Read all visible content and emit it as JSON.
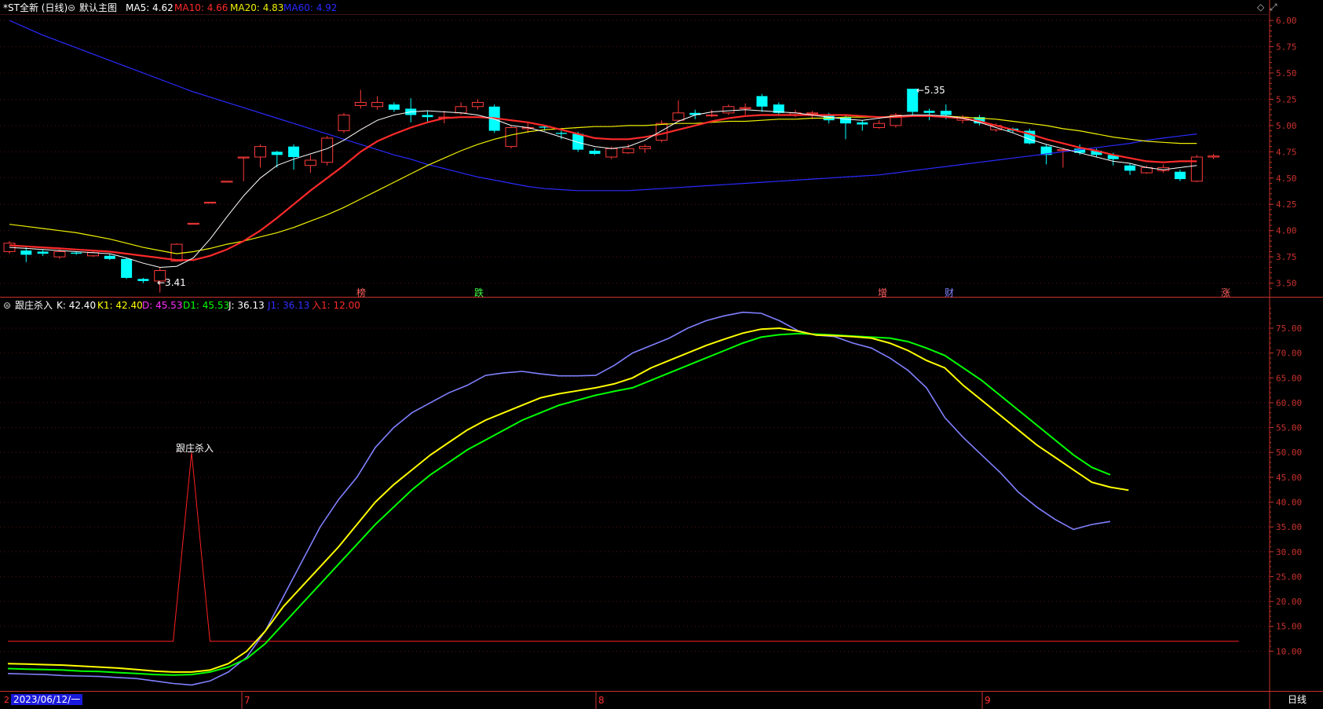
{
  "header": {
    "title": "*ST全新 (日线)",
    "main_chart_name": "默认主图",
    "ma5_label": "MA5: 4.62",
    "ma10_label": "MA10: 4.66",
    "ma20_label": "MA20: 4.83",
    "ma60_label": "MA60: 4.92"
  },
  "indicator_header": {
    "name": "跟庄杀入",
    "k_label": "K: 42.40",
    "k1_label": "K1: 42.40",
    "d_label": "D: 45.53",
    "d1_label": "D1: 45.53",
    "j_label": "J: 36.13",
    "j1_label": "J1: 36.13",
    "r1_label": "入1: 12.00"
  },
  "colors": {
    "ma5": "#ffffff",
    "ma10": "#ff2a2a",
    "ma20": "#f0f000",
    "ma60": "#2a2aff",
    "up": "#ff3a3a",
    "down": "#00ffff",
    "k": "#ffff00",
    "d": "#00ff00",
    "j": "#8080ff",
    "signal": "#ff2020",
    "axis": "#c8322d"
  },
  "markers": {
    "low_label": "←3.41",
    "high_label": "←5.35",
    "event_tags": [
      "榜",
      "跌",
      "增",
      "财",
      "涨"
    ],
    "signal_label": "跟庄杀入"
  },
  "footer": {
    "date_label": "2023/06/12/一",
    "month_7": "7",
    "month_8": "8",
    "month_9": "9",
    "period_button": "日线"
  },
  "chart_data": {
    "type": "candlestick",
    "price_axis": {
      "ylim": [
        3.37,
        6.06
      ],
      "ticks": [
        "6.00",
        "5.75",
        "5.50",
        "5.25",
        "5.00",
        "4.75",
        "4.50",
        "4.25",
        "4.00",
        "3.75",
        "3.50"
      ]
    },
    "indicator_axis": {
      "ylim": [
        2,
        81
      ],
      "ticks": [
        "75.00",
        "70.00",
        "65.00",
        "60.00",
        "55.00",
        "50.00",
        "45.00",
        "40.00",
        "35.00",
        "30.00",
        "25.00",
        "20.00",
        "15.00",
        "10.00"
      ]
    },
    "candles": [
      {
        "o": 3.8,
        "c": 3.88,
        "h": 3.9,
        "l": 3.78
      },
      {
        "o": 3.81,
        "c": 3.77,
        "h": 3.84,
        "l": 3.7
      },
      {
        "o": 3.8,
        "c": 3.78,
        "h": 3.82,
        "l": 3.76
      },
      {
        "o": 3.75,
        "c": 3.8,
        "h": 3.82,
        "l": 3.73
      },
      {
        "o": 3.79,
        "c": 3.78,
        "h": 3.8,
        "l": 3.77
      },
      {
        "o": 3.76,
        "c": 3.79,
        "h": 3.81,
        "l": 3.75
      },
      {
        "o": 3.76,
        "c": 3.73,
        "h": 3.78,
        "l": 3.72
      },
      {
        "o": 3.73,
        "c": 3.55,
        "h": 3.74,
        "l": 3.54
      },
      {
        "o": 3.54,
        "c": 3.52,
        "h": 3.55,
        "l": 3.5
      },
      {
        "o": 3.52,
        "c": 3.62,
        "h": 3.65,
        "l": 3.41
      },
      {
        "o": 3.71,
        "c": 3.87,
        "h": 3.88,
        "l": 3.71
      },
      {
        "o": 4.07,
        "c": 4.07,
        "h": 4.07,
        "l": 4.07
      },
      {
        "o": 4.27,
        "c": 4.27,
        "h": 4.27,
        "l": 4.27
      },
      {
        "o": 4.47,
        "c": 4.47,
        "h": 4.47,
        "l": 4.47
      },
      {
        "o": 4.7,
        "c": 4.7,
        "h": 4.7,
        "l": 4.47
      },
      {
        "o": 4.7,
        "c": 4.8,
        "h": 4.82,
        "l": 4.6
      },
      {
        "o": 4.75,
        "c": 4.72,
        "h": 4.76,
        "l": 4.6
      },
      {
        "o": 4.8,
        "c": 4.7,
        "h": 4.82,
        "l": 4.58
      },
      {
        "o": 4.62,
        "c": 4.67,
        "h": 4.72,
        "l": 4.55
      },
      {
        "o": 4.65,
        "c": 4.88,
        "h": 4.9,
        "l": 4.62
      },
      {
        "o": 4.95,
        "c": 5.1,
        "h": 5.12,
        "l": 4.93
      },
      {
        "o": 5.19,
        "c": 5.22,
        "h": 5.34,
        "l": 5.16
      },
      {
        "o": 5.18,
        "c": 5.22,
        "h": 5.28,
        "l": 5.15
      },
      {
        "o": 5.2,
        "c": 5.15,
        "h": 5.22,
        "l": 5.13
      },
      {
        "o": 5.16,
        "c": 5.1,
        "h": 5.26,
        "l": 5.03
      },
      {
        "o": 5.1,
        "c": 5.08,
        "h": 5.14,
        "l": 5.02
      },
      {
        "o": 5.08,
        "c": 5.08,
        "h": 5.14,
        "l": 5.02
      },
      {
        "o": 5.12,
        "c": 5.18,
        "h": 5.22,
        "l": 5.1
      },
      {
        "o": 5.18,
        "c": 5.22,
        "h": 5.25,
        "l": 5.15
      },
      {
        "o": 5.18,
        "c": 4.95,
        "h": 5.2,
        "l": 4.93
      },
      {
        "o": 4.8,
        "c": 4.98,
        "h": 5.0,
        "l": 4.78
      },
      {
        "o": 4.97,
        "c": 4.98,
        "h": 5.03,
        "l": 4.93
      },
      {
        "o": 4.99,
        "c": 4.98,
        "h": 5.0,
        "l": 4.95
      },
      {
        "o": 4.93,
        "c": 4.92,
        "h": 4.95,
        "l": 4.87
      },
      {
        "o": 4.92,
        "c": 4.77,
        "h": 4.94,
        "l": 4.75
      },
      {
        "o": 4.76,
        "c": 4.73,
        "h": 4.78,
        "l": 4.72
      },
      {
        "o": 4.7,
        "c": 4.78,
        "h": 4.8,
        "l": 4.68
      },
      {
        "o": 4.74,
        "c": 4.78,
        "h": 4.82,
        "l": 4.73
      },
      {
        "o": 4.78,
        "c": 4.8,
        "h": 4.82,
        "l": 4.74
      },
      {
        "o": 4.86,
        "c": 5.02,
        "h": 5.05,
        "l": 4.84
      },
      {
        "o": 5.05,
        "c": 5.12,
        "h": 5.24,
        "l": 5.04
      },
      {
        "o": 5.12,
        "c": 5.1,
        "h": 5.15,
        "l": 5.06
      },
      {
        "o": 5.1,
        "c": 5.1,
        "h": 5.15,
        "l": 5.08
      },
      {
        "o": 5.12,
        "c": 5.18,
        "h": 5.2,
        "l": 5.1
      },
      {
        "o": 5.17,
        "c": 5.17,
        "h": 5.21,
        "l": 5.1
      },
      {
        "o": 5.28,
        "c": 5.18,
        "h": 5.3,
        "l": 5.13
      },
      {
        "o": 5.2,
        "c": 5.12,
        "h": 5.22,
        "l": 5.1
      },
      {
        "o": 5.1,
        "c": 5.12,
        "h": 5.15,
        "l": 5.08
      },
      {
        "o": 5.12,
        "c": 5.12,
        "h": 5.14,
        "l": 5.06
      },
      {
        "o": 5.1,
        "c": 5.05,
        "h": 5.12,
        "l": 5.02
      },
      {
        "o": 5.08,
        "c": 5.02,
        "h": 5.1,
        "l": 4.87
      },
      {
        "o": 5.03,
        "c": 5.01,
        "h": 5.05,
        "l": 4.95
      },
      {
        "o": 4.98,
        "c": 5.02,
        "h": 5.05,
        "l": 4.97
      },
      {
        "o": 5.0,
        "c": 5.1,
        "h": 5.12,
        "l": 4.98
      },
      {
        "o": 5.35,
        "c": 5.13,
        "h": 5.35,
        "l": 5.1
      },
      {
        "o": 5.14,
        "c": 5.12,
        "h": 5.16,
        "l": 5.05
      },
      {
        "o": 5.14,
        "c": 5.1,
        "h": 5.2,
        "l": 5.06
      },
      {
        "o": 5.05,
        "c": 5.08,
        "h": 5.1,
        "l": 5.02
      },
      {
        "o": 5.08,
        "c": 5.02,
        "h": 5.1,
        "l": 5.0
      },
      {
        "o": 4.96,
        "c": 5.0,
        "h": 5.02,
        "l": 4.94
      },
      {
        "o": 4.97,
        "c": 4.95,
        "h": 4.98,
        "l": 4.93
      },
      {
        "o": 4.95,
        "c": 4.83,
        "h": 4.97,
        "l": 4.82
      },
      {
        "o": 4.8,
        "c": 4.72,
        "h": 4.82,
        "l": 4.63
      },
      {
        "o": 4.77,
        "c": 4.77,
        "h": 4.78,
        "l": 4.6
      },
      {
        "o": 4.78,
        "c": 4.74,
        "h": 4.82,
        "l": 4.72
      },
      {
        "o": 4.76,
        "c": 4.72,
        "h": 4.78,
        "l": 4.7
      },
      {
        "o": 4.72,
        "c": 4.68,
        "h": 4.74,
        "l": 4.62
      },
      {
        "o": 4.62,
        "c": 4.57,
        "h": 4.64,
        "l": 4.53
      },
      {
        "o": 4.55,
        "c": 4.6,
        "h": 4.62,
        "l": 4.54
      },
      {
        "o": 4.57,
        "c": 4.6,
        "h": 4.63,
        "l": 4.55
      },
      {
        "o": 4.56,
        "c": 4.49,
        "h": 4.58,
        "l": 4.47
      },
      {
        "o": 4.47,
        "c": 4.7,
        "h": 4.72,
        "l": 4.46
      },
      {
        "o": 4.7,
        "c": 4.71,
        "h": 4.73,
        "l": 4.68
      }
    ],
    "ma5": [
      3.84,
      3.83,
      3.82,
      3.81,
      3.8,
      3.79,
      3.78,
      3.74,
      3.69,
      3.65,
      3.66,
      3.74,
      3.92,
      4.13,
      4.33,
      4.5,
      4.62,
      4.68,
      4.73,
      4.78,
      4.86,
      4.96,
      5.05,
      5.1,
      5.13,
      5.14,
      5.13,
      5.12,
      5.1,
      5.06,
      5.0,
      4.98,
      4.94,
      4.89,
      4.84,
      4.8,
      4.78,
      4.8,
      4.86,
      4.95,
      5.04,
      5.1,
      5.13,
      5.14,
      5.15,
      5.14,
      5.13,
      5.12,
      5.1,
      5.08,
      5.06,
      5.05,
      5.07,
      5.09,
      5.1,
      5.1,
      5.09,
      5.07,
      5.03,
      4.98,
      4.93,
      4.87,
      4.82,
      4.78,
      4.74,
      4.7,
      4.66,
      4.64,
      4.6,
      4.58,
      4.6,
      4.62
    ],
    "ma10": [
      3.86,
      3.85,
      3.84,
      3.83,
      3.82,
      3.81,
      3.8,
      3.78,
      3.76,
      3.74,
      3.72,
      3.72,
      3.76,
      3.82,
      3.9,
      4.0,
      4.12,
      4.25,
      4.38,
      4.5,
      4.62,
      4.75,
      4.85,
      4.92,
      4.98,
      5.03,
      5.07,
      5.08,
      5.08,
      5.07,
      5.05,
      5.03,
      5.0,
      4.96,
      4.92,
      4.88,
      4.87,
      4.87,
      4.89,
      4.92,
      4.96,
      5.0,
      5.04,
      5.07,
      5.09,
      5.1,
      5.1,
      5.1,
      5.1,
      5.1,
      5.1,
      5.09,
      5.08,
      5.08,
      5.09,
      5.09,
      5.08,
      5.07,
      5.04,
      5.0,
      4.96,
      4.92,
      4.87,
      4.83,
      4.79,
      4.76,
      4.72,
      4.69,
      4.66,
      4.65,
      4.66,
      4.66
    ],
    "ma20": [
      4.06,
      4.04,
      4.02,
      4.0,
      3.98,
      3.95,
      3.92,
      3.88,
      3.84,
      3.81,
      3.78,
      3.8,
      3.83,
      3.87,
      3.9,
      3.94,
      3.98,
      4.03,
      4.09,
      4.15,
      4.22,
      4.3,
      4.38,
      4.46,
      4.54,
      4.62,
      4.69,
      4.76,
      4.82,
      4.87,
      4.91,
      4.94,
      4.96,
      4.97,
      4.98,
      4.99,
      4.99,
      5.0,
      5.0,
      5.01,
      5.02,
      5.02,
      5.03,
      5.04,
      5.04,
      5.05,
      5.06,
      5.06,
      5.07,
      5.07,
      5.08,
      5.08,
      5.08,
      5.09,
      5.09,
      5.09,
      5.09,
      5.08,
      5.07,
      5.06,
      5.04,
      5.02,
      5.0,
      4.97,
      4.95,
      4.92,
      4.89,
      4.87,
      4.85,
      4.84,
      4.83,
      4.83
    ],
    "ma60": [
      6.0,
      5.93,
      5.86,
      5.8,
      5.74,
      5.68,
      5.62,
      5.56,
      5.5,
      5.44,
      5.38,
      5.32,
      5.27,
      5.22,
      5.17,
      5.12,
      5.07,
      5.02,
      4.97,
      4.92,
      4.87,
      4.82,
      4.77,
      4.72,
      4.68,
      4.63,
      4.59,
      4.55,
      4.51,
      4.48,
      4.45,
      4.42,
      4.4,
      4.39,
      4.38,
      4.38,
      4.38,
      4.38,
      4.39,
      4.4,
      4.41,
      4.42,
      4.43,
      4.44,
      4.45,
      4.46,
      4.47,
      4.48,
      4.49,
      4.5,
      4.51,
      4.52,
      4.53,
      4.55,
      4.57,
      4.59,
      4.61,
      4.63,
      4.65,
      4.67,
      4.69,
      4.71,
      4.73,
      4.75,
      4.77,
      4.79,
      4.81,
      4.83,
      4.86,
      4.88,
      4.9,
      4.92
    ],
    "K": [
      7.5,
      7.4,
      7.3,
      7.2,
      7.0,
      6.8,
      6.6,
      6.3,
      6.0,
      5.8,
      5.8,
      6.2,
      7.5,
      10.0,
      14.0,
      19.0,
      23.0,
      27.0,
      31.0,
      35.5,
      40.0,
      43.5,
      46.5,
      49.5,
      52.0,
      54.5,
      56.5,
      58.0,
      59.5,
      61.0,
      61.8,
      62.4,
      63.0,
      63.8,
      65.0,
      67.0,
      68.5,
      70.0,
      71.5,
      72.8,
      74.0,
      74.8,
      75.0,
      74.4,
      73.6,
      73.5,
      73.3,
      73.0,
      72.0,
      70.5,
      68.5,
      67.0,
      63.5,
      60.5,
      57.5,
      54.5,
      51.5,
      49.0,
      46.5,
      44.0,
      43.0,
      42.4
    ],
    "D": [
      6.5,
      6.4,
      6.3,
      6.2,
      6.0,
      5.9,
      5.7,
      5.5,
      5.3,
      5.2,
      5.3,
      5.8,
      6.8,
      8.5,
      11.5,
      15.5,
      19.5,
      23.5,
      27.5,
      31.5,
      35.5,
      39.0,
      42.5,
      45.5,
      48.0,
      50.5,
      52.5,
      54.5,
      56.5,
      58.0,
      59.5,
      60.5,
      61.5,
      62.3,
      63.0,
      64.5,
      66.0,
      67.5,
      69.0,
      70.5,
      72.0,
      73.2,
      73.7,
      73.9,
      73.8,
      73.6,
      73.4,
      73.2,
      73.0,
      72.3,
      71.0,
      69.5,
      67.0,
      64.5,
      61.5,
      58.5,
      55.5,
      52.5,
      49.5,
      47.0,
      45.5
    ],
    "J": [
      5.5,
      5.4,
      5.3,
      5.1,
      5.0,
      4.9,
      4.7,
      4.5,
      4.0,
      3.5,
      3.2,
      4.0,
      5.8,
      8.8,
      14.0,
      21.0,
      28.0,
      35.0,
      40.5,
      45.0,
      51.0,
      55.0,
      58.0,
      60.0,
      62.0,
      63.5,
      65.5,
      66.0,
      66.3,
      65.8,
      65.4,
      65.4,
      65.5,
      67.5,
      70.0,
      71.5,
      73.0,
      75.0,
      76.5,
      77.5,
      78.2,
      78.0,
      76.5,
      74.5,
      73.6,
      73.3,
      72.0,
      71.0,
      69.0,
      66.5,
      63.0,
      57.0,
      53.0,
      49.5,
      46.0,
      42.0,
      39.0,
      36.5,
      34.5,
      35.5,
      36.1
    ],
    "signal": [
      12,
      12,
      12,
      12,
      12,
      12,
      12,
      12,
      12,
      12,
      50,
      12,
      12,
      12,
      12,
      12,
      12,
      12,
      12,
      12,
      12,
      12,
      12,
      12,
      12,
      12,
      12,
      12,
      12,
      12,
      12,
      12,
      12,
      12,
      12,
      12,
      12,
      12,
      12,
      12,
      12,
      12,
      12,
      12,
      12,
      12,
      12,
      12,
      12,
      12,
      12,
      12,
      12,
      12,
      12,
      12,
      12,
      12,
      12,
      12,
      12,
      12,
      12,
      12,
      12,
      12,
      12,
      12,
      12,
      12,
      12,
      12,
      12
    ]
  }
}
